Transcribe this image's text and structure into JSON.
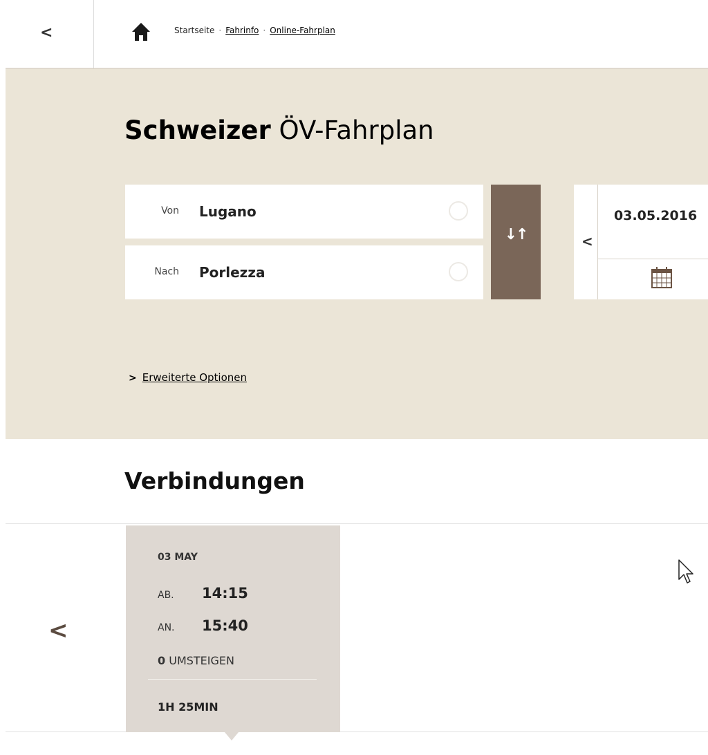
{
  "nav": {
    "back_label": "<",
    "breadcrumb": {
      "home": "Startseite",
      "separator": "·",
      "item1": "Fahrinfo",
      "item2": "Online-Fahrplan"
    }
  },
  "search": {
    "title_bold": "Schweizer",
    "title_rest": "ÖV-Fahrplan",
    "from_label": "Von",
    "from_value": "Lugano",
    "to_label": "Nach",
    "to_value": "Porlezza",
    "swap_label": "↓↑",
    "date_prev": "<",
    "date_value": "03.05.2016",
    "options_chevron": ">",
    "options_label": "Erweiterte Optionen"
  },
  "results": {
    "title": "Verbindungen",
    "prev_label": "<",
    "connections": [
      {
        "date": "03 MAY",
        "dep_label": "AB.",
        "dep_time": "14:15",
        "arr_label": "AN.",
        "arr_time": "15:40",
        "transfers_count": "0",
        "transfers_label": "UMSTEIGEN",
        "duration": "1H 25MIN"
      }
    ]
  },
  "colors": {
    "panel_bg": "#ebe5d7",
    "swap_button": "#7a6658",
    "card_bg": "#ded8d2",
    "accent_brown": "#5b4b40"
  },
  "icons": {
    "home": "home-icon",
    "calendar": "calendar-icon",
    "location": "location-circle-icon",
    "cursor": "mouse-pointer-icon"
  }
}
